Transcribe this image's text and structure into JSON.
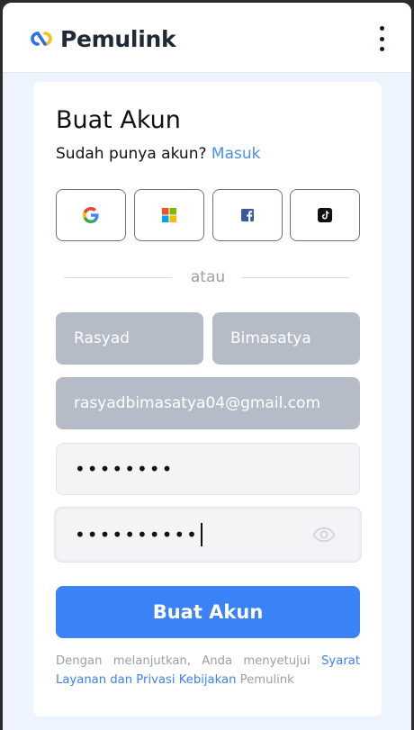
{
  "header": {
    "brand": "Pemulink",
    "logo_icon": "chain-link-logo",
    "menu_icon": "kebab-menu-icon"
  },
  "form": {
    "title": "Buat Akun",
    "subtitle_text": "Sudah punya akun?",
    "login_link": "Masuk",
    "social_buttons": [
      {
        "name": "google",
        "icon": "google-icon"
      },
      {
        "name": "microsoft",
        "icon": "microsoft-icon"
      },
      {
        "name": "facebook",
        "icon": "facebook-icon"
      },
      {
        "name": "tiktok",
        "icon": "tiktok-icon"
      }
    ],
    "divider_text": "atau",
    "first_name": "Rasyad",
    "last_name": "Bimasatya",
    "email": "rasyadbimasatya04@gmail.com",
    "password_mask": "••••••••",
    "confirm_password_mask": "••••••••••",
    "submit_label": "Buat Akun",
    "terms_prefix": "Dengan melanjutkan, Anda menyetujui",
    "terms_link": "Syarat Layanan dan Privasi Kebijakan",
    "terms_suffix": "Pemulink"
  },
  "colors": {
    "accent": "#3b82f6",
    "link": "#4a90e2",
    "filled_field": "#b5bcc8",
    "background": "#eef4fd"
  }
}
